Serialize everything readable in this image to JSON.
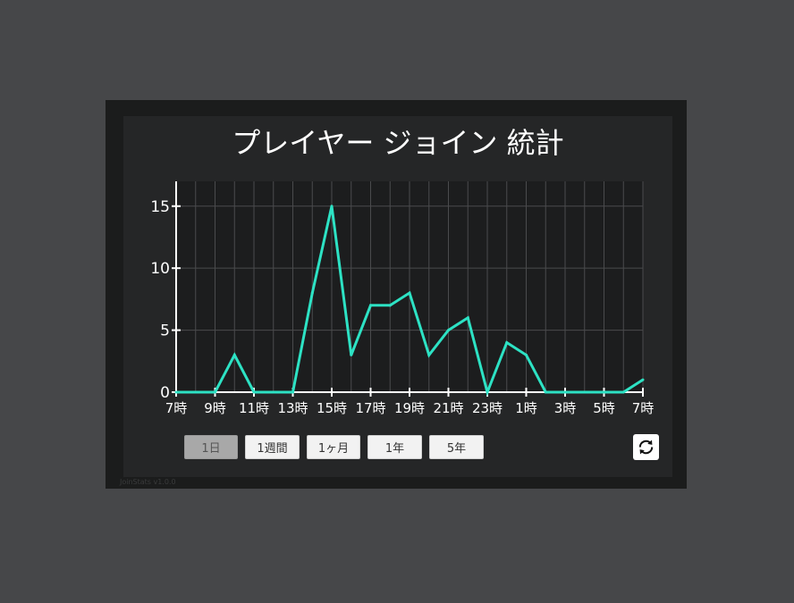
{
  "title": "プレイヤー ジョイン 統計",
  "ranges": [
    {
      "label": "1日",
      "active": true
    },
    {
      "label": "1週間",
      "active": false
    },
    {
      "label": "1ヶ月",
      "active": false
    },
    {
      "label": "1年",
      "active": false
    },
    {
      "label": "5年",
      "active": false
    }
  ],
  "version": "JoinStats v1.0.0",
  "colors": {
    "line": "#2de2c4",
    "background": "#464749",
    "panel": "#252627",
    "plot": "#1c1d1e",
    "grid": "#4a4b4d"
  },
  "icons": {
    "refresh": "refresh-icon"
  },
  "chart_data": {
    "type": "line",
    "title": "プレイヤー ジョイン 統計",
    "xlabel": "",
    "ylabel": "",
    "x_tick_labels": [
      "7時",
      "9時",
      "11時",
      "13時",
      "15時",
      "17時",
      "19時",
      "21時",
      "23時",
      "1時",
      "3時",
      "5時",
      "7時"
    ],
    "ylim": [
      0,
      17
    ],
    "y_ticks": [
      0,
      5,
      10,
      15
    ],
    "grid": true,
    "series": [
      {
        "values": [
          0,
          0,
          0,
          3,
          0,
          0,
          0,
          8,
          15,
          3,
          7,
          7,
          8,
          3,
          5,
          6,
          0,
          4,
          3,
          0,
          0,
          0,
          0,
          0,
          1
        ]
      }
    ]
  }
}
